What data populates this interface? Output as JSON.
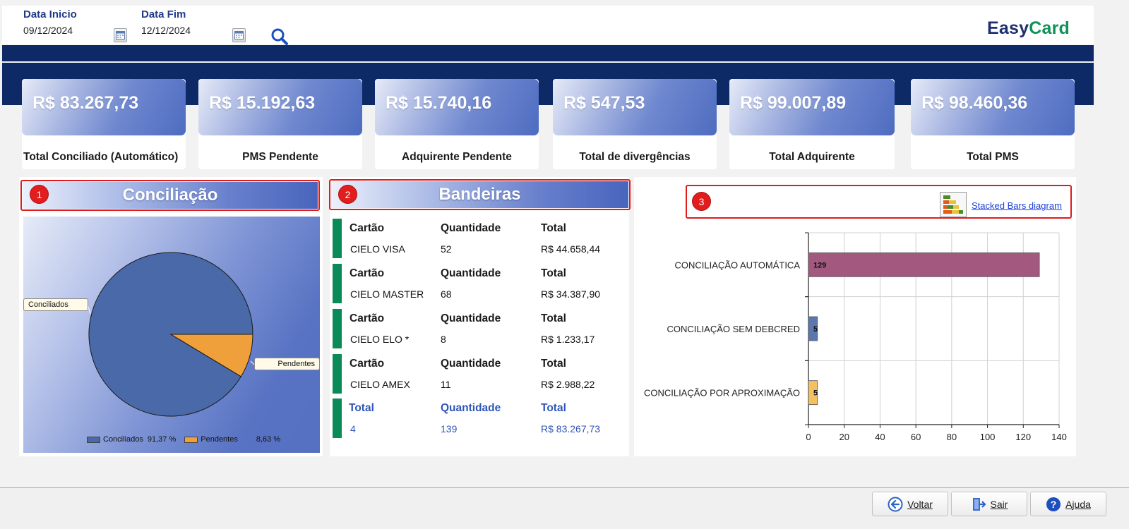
{
  "filters": {
    "start_label": "Data Inicio",
    "start_value": "09/12/2024",
    "end_label": "Data Fim",
    "end_value": "12/12/2024"
  },
  "brand": {
    "part1": "Easy",
    "part2": "Card"
  },
  "kpis": [
    {
      "amount": "R$ 83.267,73",
      "caption": "Total Conciliado (Automático)"
    },
    {
      "amount": "R$ 15.192,63",
      "caption": "PMS Pendente"
    },
    {
      "amount": "R$ 15.740,16",
      "caption": "Adquirente Pendente"
    },
    {
      "amount": "R$ 547,53",
      "caption": "Total de divergências"
    },
    {
      "amount": "R$ 99.007,89",
      "caption": "Total Adquirente"
    },
    {
      "amount": "R$ 98.460,36",
      "caption": "Total PMS"
    }
  ],
  "badges": [
    "1",
    "2",
    "3"
  ],
  "conciliacao": {
    "title": "Conciliação",
    "callouts": {
      "conciliados": "Conciliados",
      "pendentes": "Pendentes"
    },
    "legend": [
      {
        "label": "Conciliados",
        "pct": "91,37 %",
        "color": "#4a69a8"
      },
      {
        "label": "Pendentes",
        "pct": "8,63 %",
        "color": "#f0a03a"
      }
    ],
    "chart_data": {
      "type": "pie",
      "slices": [
        {
          "label": "Conciliados",
          "value": 91.37,
          "color": "#4a69a8"
        },
        {
          "label": "Pendentes",
          "value": 8.63,
          "color": "#f0a03a"
        }
      ]
    }
  },
  "bandeiras": {
    "title": "Bandeiras",
    "col_headers": {
      "card": "Cartão",
      "qty": "Quantidade",
      "total": "Total"
    },
    "rows": [
      {
        "card": "CIELO VISA",
        "qty": "52",
        "total": "R$ 44.658,44"
      },
      {
        "card": "CIELO MASTER",
        "qty": "68",
        "total": "R$ 34.387,90"
      },
      {
        "card": "CIELO ELO *",
        "qty": "8",
        "total": "R$ 1.233,17"
      },
      {
        "card": "CIELO AMEX",
        "qty": "11",
        "total": "R$ 2.988,22"
      }
    ],
    "total_headers": {
      "card": "Total",
      "qty": "Quantidade",
      "total": "Total"
    },
    "total_row": {
      "card": "4",
      "qty": "139",
      "total": "R$ 83.267,73"
    }
  },
  "stacked": {
    "link_label": "Stacked Bars diagram",
    "icon": "stacked-bars-icon"
  },
  "chart_data": {
    "type": "bar",
    "orientation": "horizontal",
    "categories": [
      "CONCILIAÇÃO AUTOMÁTICA",
      "CONCILIAÇÃO SEM DEBCRED",
      "CONCILIAÇÃO POR APROXIMAÇÃO"
    ],
    "values": [
      129,
      5,
      5
    ],
    "colors": [
      "#a3597f",
      "#5a77b0",
      "#f5c060"
    ],
    "xlim": [
      0,
      140
    ],
    "xticks": [
      0,
      20,
      40,
      60,
      80,
      100,
      120,
      140
    ],
    "grid": true
  },
  "footer": {
    "voltar": "Voltar",
    "sair": "Sair",
    "ajuda": "Ajuda"
  }
}
